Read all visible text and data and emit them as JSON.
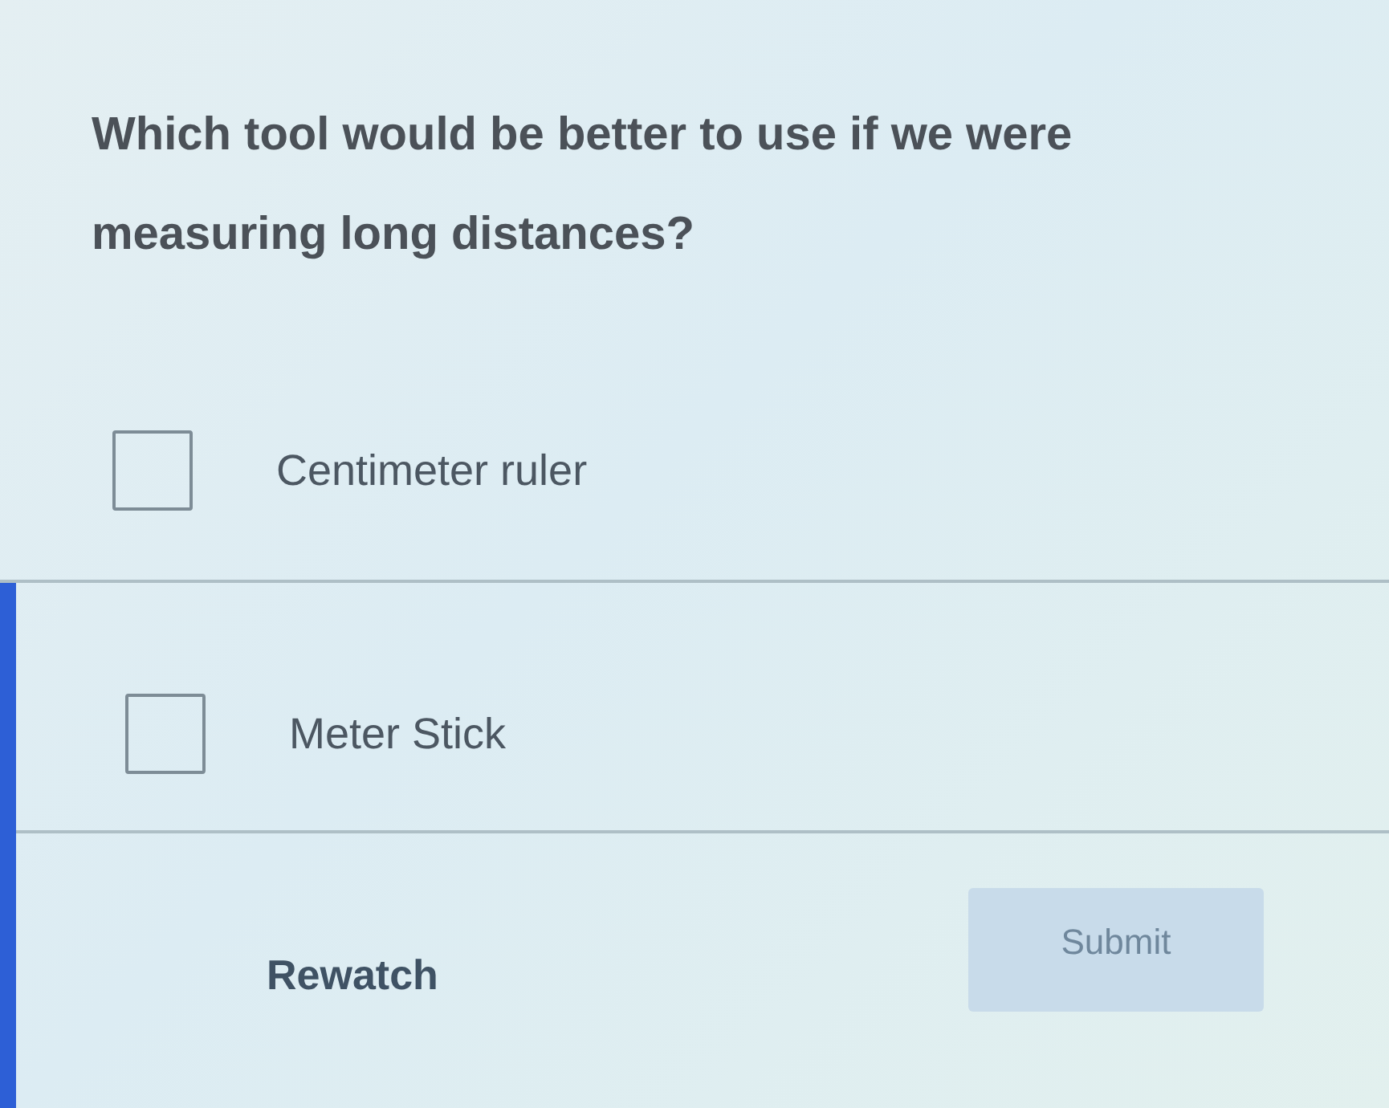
{
  "question": "Which tool would be better to use if we were measuring long distances?",
  "options": [
    {
      "label": "Centimeter ruler",
      "checked": false
    },
    {
      "label": "Meter Stick",
      "checked": false
    }
  ],
  "actions": {
    "rewatch": "Rewatch",
    "submit": {
      "label": "Submit",
      "disabled": true
    }
  }
}
